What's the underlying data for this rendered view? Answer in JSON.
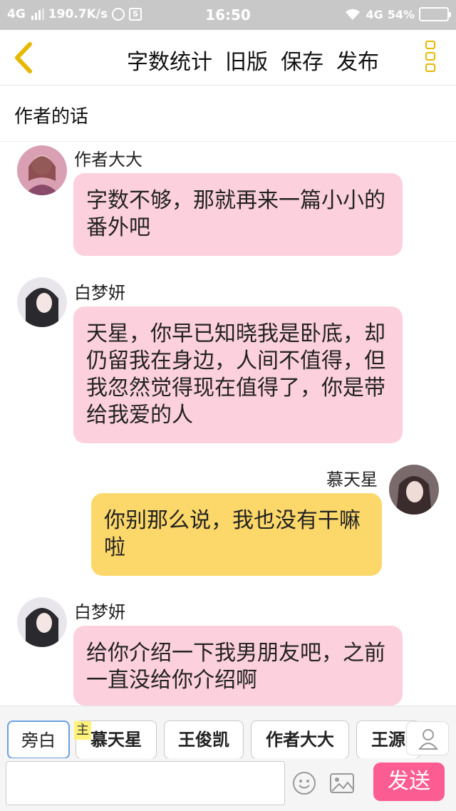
{
  "status_bar": {
    "network": "4G",
    "speed": "190.7K/s",
    "extra_icon": "S",
    "time": "16:50",
    "network_right": "4G",
    "battery": "54%"
  },
  "header": {
    "actions": [
      "字数统计",
      "旧版",
      "保存",
      "发布"
    ]
  },
  "note": {
    "label": "作者的话"
  },
  "messages": [
    {
      "sender": "作者大大",
      "text": "字数不够，那就再来一篇小小的番外吧",
      "side": "left"
    },
    {
      "sender": "白梦妍",
      "text": "天星，你早已知晓我是卧底，却仍留我在身边，人间不值得，但我忽然觉得现在值得了，你是带给我爱的人",
      "side": "left"
    },
    {
      "sender": "慕天星",
      "text": "你别那么说，我也没有干嘛啦",
      "side": "right"
    },
    {
      "sender": "白梦妍",
      "text": "给你介绍一下我男朋友吧，之前一直没给你介绍啊",
      "side": "left"
    }
  ],
  "roles": [
    "旁白",
    "慕天星",
    "王俊凯",
    "作者大大",
    "王源"
  ],
  "main_tag": "主",
  "input": {
    "value": "",
    "placeholder": ""
  },
  "send_label": "发送",
  "colors": {
    "accent": "#e7b800",
    "pink_bubble": "#fcd0dc",
    "yellow_bubble": "#fcd86a",
    "send": "#fb5d92"
  }
}
